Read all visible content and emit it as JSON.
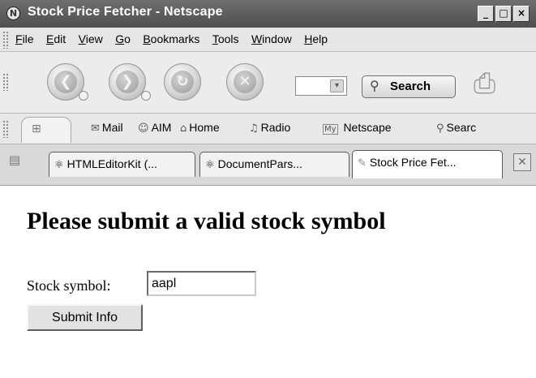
{
  "window": {
    "title": "Stock Price Fetcher - Netscape",
    "controls": {
      "minimize": "_",
      "maximize": "□",
      "close": "×"
    }
  },
  "menubar": {
    "items": [
      {
        "mnemonic": "F",
        "rest": "ile"
      },
      {
        "mnemonic": "E",
        "rest": "dit"
      },
      {
        "mnemonic": "V",
        "rest": "iew"
      },
      {
        "mnemonic": "G",
        "rest": "o"
      },
      {
        "mnemonic": "B",
        "rest": "ookmarks"
      },
      {
        "mnemonic": "T",
        "rest": "ools"
      },
      {
        "mnemonic": "W",
        "rest": "indow"
      },
      {
        "mnemonic": "H",
        "rest": "elp"
      }
    ]
  },
  "navbar": {
    "back_icon": "back-arrow-icon",
    "forward_icon": "forward-arrow-icon",
    "reload_icon": "reload-icon",
    "stop_icon": "stop-icon",
    "search_label": "Search",
    "print_icon": "print-icon"
  },
  "personal_toolbar": {
    "items": [
      "Mail",
      "AIM",
      "Home",
      "Radio",
      "Netscape",
      "Searc"
    ],
    "netscape_badge": "My"
  },
  "tabs": {
    "items": [
      "HTMLEditorKit (...",
      "DocumentPars...",
      "Stock Price Fet..."
    ],
    "active_index": 2
  },
  "page": {
    "heading": "Please submit a valid stock symbol",
    "field_label": "Stock symbol:",
    "field_value": "aapl",
    "submit_label": "Submit Info"
  }
}
